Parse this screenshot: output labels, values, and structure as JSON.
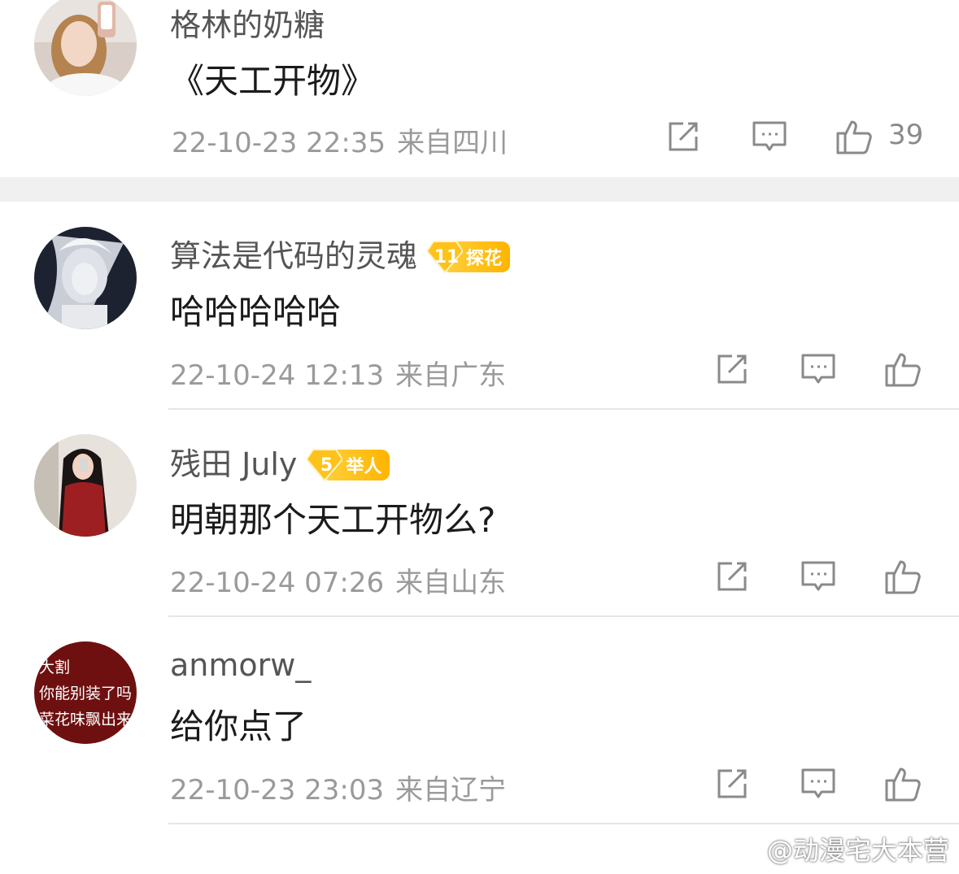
{
  "comments": [
    {
      "username": "格林的奶糖",
      "text": "《天工开物》",
      "time": "22-10-23 22:35",
      "location": "来自四川",
      "likes": "39",
      "badge": null
    },
    {
      "username": "算法是代码的灵魂",
      "text": "哈哈哈哈哈",
      "time": "22-10-24 12:13",
      "location": "来自广东",
      "likes": "",
      "badge": {
        "level": "11",
        "label": "探花"
      }
    },
    {
      "username": "残田 July",
      "text": "明朝那个天工开物么?",
      "time": "22-10-24 07:26",
      "location": "来自山东",
      "likes": "",
      "badge": {
        "level": "5",
        "label": "举人"
      }
    },
    {
      "username": "anmorw_",
      "text": "给你点了",
      "time": "22-10-23 23:03",
      "location": "来自辽宁",
      "likes": "",
      "badge": null,
      "avatar_text": [
        "大割",
        "你能别装了吗",
        "菜花味飘出来了"
      ]
    }
  ],
  "icons": {
    "share": "share-icon",
    "comment": "comment-icon",
    "like": "thumbs-up-icon"
  },
  "watermark": "@动漫宅大本营",
  "colors": {
    "badge": "#ffbb00",
    "meta": "#9a9a9a",
    "icon": "#8a8a8a",
    "band": "#f0f0f0"
  }
}
